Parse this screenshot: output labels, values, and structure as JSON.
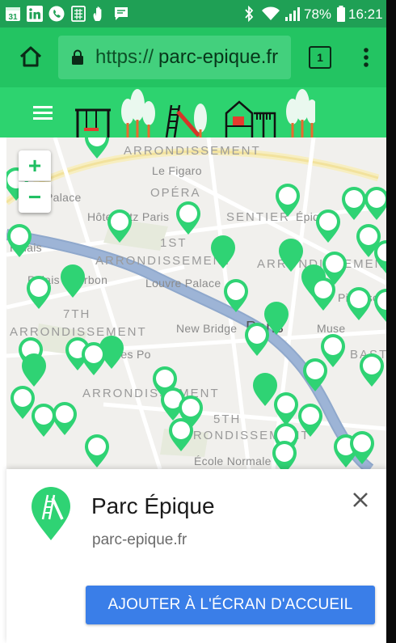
{
  "status_bar": {
    "calendar_day": "31",
    "battery": "78%",
    "time": "16:21",
    "notification_icons": [
      "calendar-icon",
      "linkedin-icon",
      "phone-icon",
      "sim-icon",
      "hand-icon",
      "message-icon"
    ],
    "system_icons": [
      "bluetooth-icon",
      "wifi-icon",
      "signal-icon",
      "battery-icon"
    ],
    "color": "#1fa055"
  },
  "browser": {
    "url_scheme": "https://",
    "url_host": "parc-epique.fr",
    "tab_count": "1",
    "toolbar_color": "#23c462"
  },
  "site": {
    "header_color": "#2dd36f"
  },
  "map": {
    "zoom_in": "+",
    "zoom_out": "−",
    "labels": {
      "arr_top": "ARRONDISSEMENT",
      "figaro": "Le Figaro",
      "opera": "OPÉRA",
      "palace": "Palace",
      "ritz": "Hôtel Ritz Paris",
      "sentier": "SENTIER",
      "epique": "Épique",
      "palais": "Palais",
      "first": "1ST",
      "arr_first": "ARRONDISSEMENT",
      "arr_right": "ARRONDISSEMENT",
      "louvre": "Louvre Palace",
      "bourbon": "Palais Bourbon",
      "seventh": "7TH",
      "arr_seventh": "ARRONDISSEMENT",
      "picasso": "Picasso",
      "muse": "Muse",
      "newbridge": "New Bridge",
      "paris": "Paris",
      "bast": "BAST",
      "ncespo": "nces Po",
      "arr_fifth": "ARRONDISSEMENT",
      "fifth": "5TH",
      "arr_fifth2": "ARRONDISSEMENT",
      "ecole": "École Normale"
    },
    "marker_color": "#2fd374"
  },
  "banner": {
    "app_name": "Parc Épique",
    "app_url": "parc-epique.fr",
    "add_button": "AJOUTER À L'ÉCRAN D'ACCUEIL",
    "button_color": "#3a7ee8"
  }
}
